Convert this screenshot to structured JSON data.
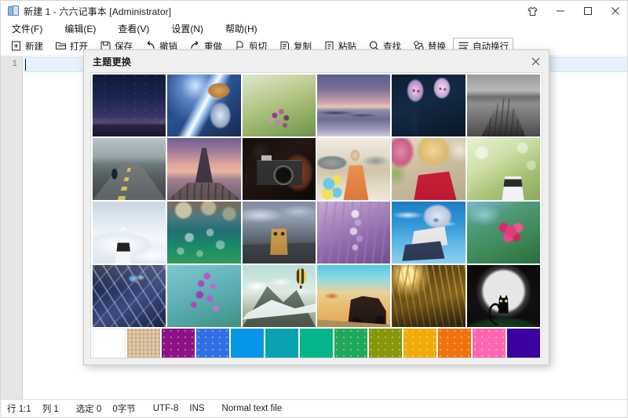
{
  "window": {
    "title": "新建 1 - 六六记事本 [Administrator]",
    "app_icon": "notepad-pages-icon",
    "controls": [
      {
        "name": "theme-button",
        "icon": "shirt-icon",
        "label": ""
      },
      {
        "name": "minimize-button",
        "icon": "minimize-icon",
        "label": ""
      },
      {
        "name": "maximize-button",
        "icon": "maximize-icon",
        "label": ""
      },
      {
        "name": "close-button",
        "icon": "close-icon",
        "label": ""
      }
    ]
  },
  "menubar": {
    "items": [
      {
        "label": "文件(F)"
      },
      {
        "label": "编辑(E)"
      },
      {
        "label": "查看(V)"
      },
      {
        "label": "设置(N)"
      },
      {
        "label": "帮助(H)"
      }
    ]
  },
  "toolbar": {
    "items": [
      {
        "label": "新建",
        "icon": "new-file-icon",
        "active": false
      },
      {
        "label": "打开",
        "icon": "folder-open-icon",
        "active": false
      },
      {
        "label": "保存",
        "icon": "save-disk-icon",
        "active": false
      },
      {
        "label": "撤销",
        "icon": "undo-arrow-icon",
        "active": false
      },
      {
        "label": "重做",
        "icon": "redo-arrow-icon",
        "active": false
      },
      {
        "label": "剪切",
        "icon": "cut-icon",
        "active": false
      },
      {
        "label": "复制",
        "icon": "copy-icon",
        "active": false
      },
      {
        "label": "粘贴",
        "icon": "paste-icon",
        "active": false
      },
      {
        "label": "查找",
        "icon": "search-icon",
        "active": false
      },
      {
        "label": "替换",
        "icon": "replace-icon",
        "active": false
      },
      {
        "label": "自动换行",
        "icon": "word-wrap-icon",
        "active": true
      }
    ]
  },
  "editor": {
    "line_numbers": [
      "1"
    ],
    "content": "",
    "current_line": 1
  },
  "statusbar": {
    "row_col": "行 1:1",
    "column": "列 1",
    "selected": "选定 0",
    "bytes": "0字节",
    "encoding": "UTF-8",
    "insert_mode": "INS",
    "file_type": "Normal text file"
  },
  "dialog": {
    "title": "主题更换",
    "close_icon": "close-icon",
    "thumbnails": [
      {
        "name": "starry-night-beach",
        "alt": "紫色星空海滩"
      },
      {
        "name": "anime-saber-blue",
        "alt": "蓝色动漫剑士"
      },
      {
        "name": "purple-flowers-green",
        "alt": "紫色小花绿地"
      },
      {
        "name": "dusk-seashore",
        "alt": "黄昏海岸"
      },
      {
        "name": "anime-dark-twins",
        "alt": "暗色动漫双人"
      },
      {
        "name": "grayscale-pier",
        "alt": "黑白木栈道"
      },
      {
        "name": "motorcycle-road",
        "alt": "公路摩托车"
      },
      {
        "name": "eiffel-tower-sunset",
        "alt": "埃菲尔铁塔日落"
      },
      {
        "name": "vintage-camera",
        "alt": "复古相机"
      },
      {
        "name": "girl-balloons-desert",
        "alt": "气球女孩沙漠"
      },
      {
        "name": "blonde-red-dress",
        "alt": "红裙女子"
      },
      {
        "name": "garden-figure-bokeh",
        "alt": "花园玩偶"
      },
      {
        "name": "snow-doll-winter",
        "alt": "雪地玩偶"
      },
      {
        "name": "blue-bokeh-bubbles",
        "alt": "蓝色气泡散景"
      },
      {
        "name": "danbo-box-robot",
        "alt": "纸箱人"
      },
      {
        "name": "wisteria-purple",
        "alt": "紫藤花"
      },
      {
        "name": "anime-girl-sky",
        "alt": "蓝天动漫少女"
      },
      {
        "name": "pink-flower-green",
        "alt": "粉红花朵"
      },
      {
        "name": "butterfly-metal-blue",
        "alt": "蓝色蝴蝶金属"
      },
      {
        "name": "lavender-teal-macro",
        "alt": "薰衣草微距"
      },
      {
        "name": "mountain-hot-air-balloon",
        "alt": "雪山热气球"
      },
      {
        "name": "desert-vintage-car",
        "alt": "沙漠老爷车"
      },
      {
        "name": "golden-wheat-sunrise",
        "alt": "金色麦田日出"
      },
      {
        "name": "black-cat-moon",
        "alt": "黑猫满月"
      }
    ],
    "swatches": [
      {
        "name": "swatch-white",
        "color": "#ffffff",
        "pattern": "none"
      },
      {
        "name": "swatch-beige",
        "color": "#e2cbaa",
        "pattern": "weave"
      },
      {
        "name": "swatch-magenta",
        "color": "#8e1086",
        "pattern": "dots"
      },
      {
        "name": "swatch-royal-blue",
        "color": "#2f6fe4",
        "pattern": "dots"
      },
      {
        "name": "swatch-azure",
        "color": "#0596e8",
        "pattern": "none"
      },
      {
        "name": "swatch-teal",
        "color": "#0aa2b0",
        "pattern": "none"
      },
      {
        "name": "swatch-emerald",
        "color": "#06b68a",
        "pattern": "none"
      },
      {
        "name": "swatch-green",
        "color": "#1fa85c",
        "pattern": "dots"
      },
      {
        "name": "swatch-olive",
        "color": "#87960a",
        "pattern": "dots"
      },
      {
        "name": "swatch-amber",
        "color": "#f0ab06",
        "pattern": "dots"
      },
      {
        "name": "swatch-orange",
        "color": "#f0720e",
        "pattern": "dots"
      },
      {
        "name": "swatch-pink",
        "color": "#ff66b2",
        "pattern": "dots"
      },
      {
        "name": "swatch-indigo",
        "color": "#3a01a0",
        "pattern": "none"
      }
    ]
  }
}
